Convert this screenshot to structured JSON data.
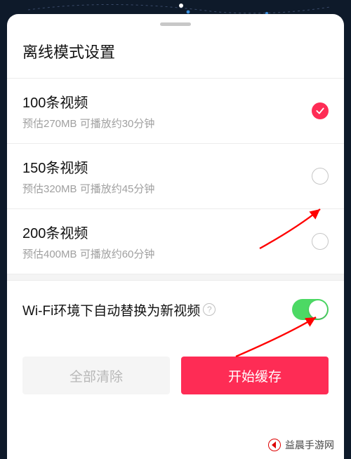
{
  "sheet": {
    "title": "离线模式设置"
  },
  "options": [
    {
      "title": "100条视频",
      "sub": "预估270MB 可播放约30分钟",
      "selected": true
    },
    {
      "title": "150条视频",
      "sub": "预估320MB 可播放约45分钟",
      "selected": false
    },
    {
      "title": "200条视频",
      "sub": "预估400MB 可播放约60分钟",
      "selected": false
    }
  ],
  "wifi": {
    "label": "Wi-Fi环境下自动替换为新视频",
    "help_symbol": "?",
    "enabled": true
  },
  "buttons": {
    "clear": "全部清除",
    "start": "开始缓存"
  },
  "colors": {
    "accent": "#fe2c55",
    "switch_on": "#4cd964"
  },
  "watermark": {
    "text": "益晨手游网"
  }
}
